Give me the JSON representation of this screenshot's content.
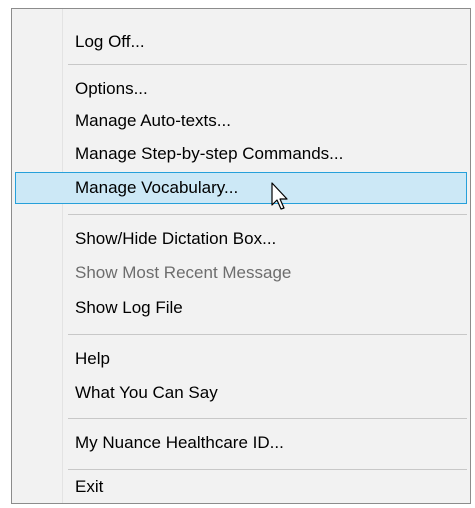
{
  "menu": {
    "items": [
      {
        "label": "Log Off...",
        "enabled": true
      },
      {
        "label": "Options...",
        "enabled": true
      },
      {
        "label": "Manage Auto-texts...",
        "enabled": true
      },
      {
        "label": "Manage Step-by-step Commands...",
        "enabled": true
      },
      {
        "label": "Manage Vocabulary...",
        "enabled": true,
        "highlighted": true
      },
      {
        "label": "Show/Hide Dictation Box...",
        "enabled": true
      },
      {
        "label": "Show Most Recent Message",
        "enabled": false
      },
      {
        "label": "Show Log File",
        "enabled": true
      },
      {
        "label": "Help",
        "enabled": true
      },
      {
        "label": "What You Can Say",
        "enabled": true
      },
      {
        "label": "My Nuance Healthcare ID...",
        "enabled": true
      },
      {
        "label": "Exit",
        "enabled": true
      }
    ]
  },
  "colors": {
    "menu_background": "#f2f2f2",
    "highlight_background": "#cce8f6",
    "highlight_border": "#26a0da",
    "disabled_text": "#6d6d6d"
  },
  "icons": {
    "cursor": "mouse-pointer-icon"
  }
}
